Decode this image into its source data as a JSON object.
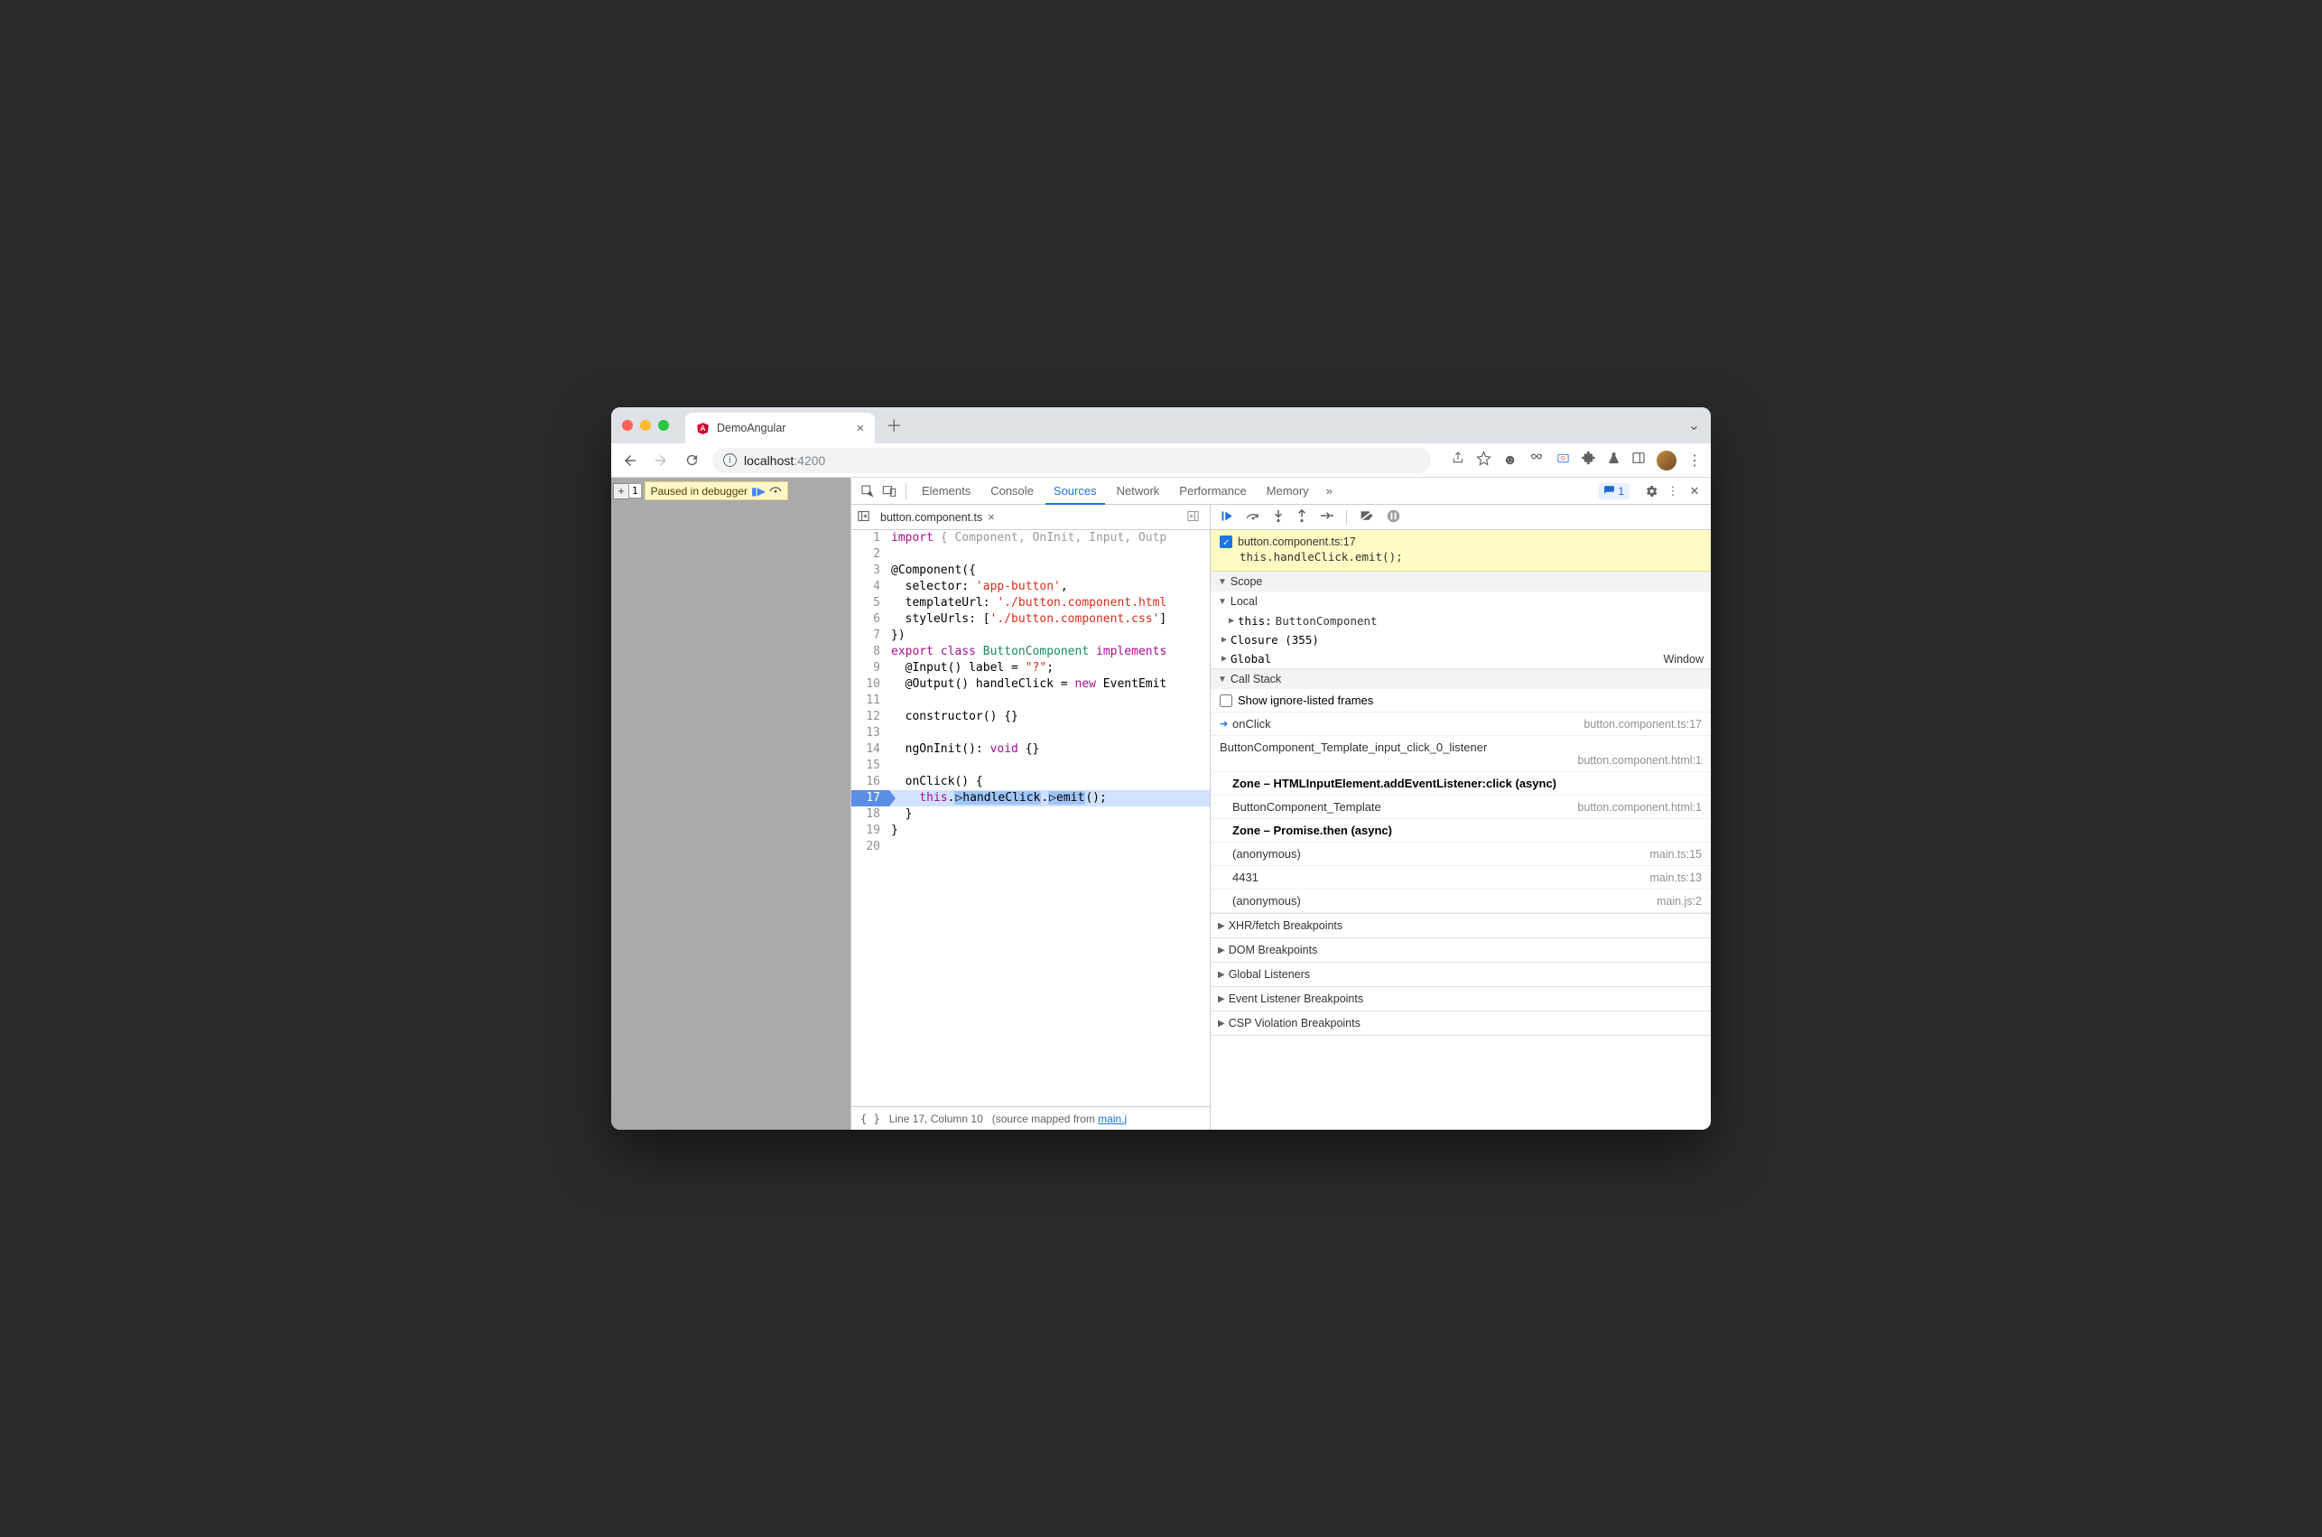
{
  "tab": {
    "title": "DemoAngular"
  },
  "url": {
    "host": "localhost",
    "port": ":4200"
  },
  "overlay": {
    "text": "Paused in debugger"
  },
  "devtools": {
    "tabs": [
      "Elements",
      "Console",
      "Sources",
      "Network",
      "Performance",
      "Memory"
    ],
    "issues_count": "1"
  },
  "editor": {
    "file": "button.component.ts",
    "status_line": "Line 17, Column 10",
    "status_mapped_prefix": "(source mapped from ",
    "status_mapped_link": "main.j",
    "lines": [
      {
        "n": "1",
        "raw": "import { Component, OnInit, Input, Outp"
      },
      {
        "n": "2",
        "raw": ""
      },
      {
        "n": "3",
        "raw": "@Component({"
      },
      {
        "n": "4",
        "raw": "  selector: 'app-button',"
      },
      {
        "n": "5",
        "raw": "  templateUrl: './button.component.html"
      },
      {
        "n": "6",
        "raw": "  styleUrls: ['./button.component.css']"
      },
      {
        "n": "7",
        "raw": "})"
      },
      {
        "n": "8",
        "raw": "export class ButtonComponent implements"
      },
      {
        "n": "9",
        "raw": "  @Input() label = \"?\";"
      },
      {
        "n": "10",
        "raw": "  @Output() handleClick = new EventEmit"
      },
      {
        "n": "11",
        "raw": ""
      },
      {
        "n": "12",
        "raw": "  constructor() {}"
      },
      {
        "n": "13",
        "raw": ""
      },
      {
        "n": "14",
        "raw": "  ngOnInit(): void {}"
      },
      {
        "n": "15",
        "raw": ""
      },
      {
        "n": "16",
        "raw": "  onClick() {"
      },
      {
        "n": "17",
        "raw": "    this.handleClick.emit();"
      },
      {
        "n": "18",
        "raw": "  }"
      },
      {
        "n": "19",
        "raw": "}"
      },
      {
        "n": "20",
        "raw": ""
      }
    ]
  },
  "bp": {
    "loc": "button.component.ts:17",
    "expr": "this.handleClick.emit();"
  },
  "sections": {
    "scope": "Scope",
    "local": "Local",
    "this_label": "this:",
    "this_val": "ButtonComponent",
    "closure": "Closure (355)",
    "global": "Global",
    "global_val": "Window",
    "callstack": "Call Stack",
    "show_ignore": "Show ignore-listed frames",
    "xhr": "XHR/fetch Breakpoints",
    "dom": "DOM Breakpoints",
    "gl": "Global Listeners",
    "ev": "Event Listener Breakpoints",
    "csp": "CSP Violation Breakpoints"
  },
  "frames": [
    {
      "arrow": true,
      "fn": "onClick",
      "loc": "button.component.ts:17"
    },
    {
      "fn": "ButtonComponent_Template_input_click_0_listener",
      "loc": "button.component.html:1",
      "wrap": true
    },
    {
      "zone": true,
      "fn": "Zone – HTMLInputElement.addEventListener:click (async)"
    },
    {
      "fn": "ButtonComponent_Template",
      "loc": "button.component.html:1"
    },
    {
      "zone": true,
      "fn": "Zone – Promise.then (async)"
    },
    {
      "fn": "(anonymous)",
      "loc": "main.ts:15"
    },
    {
      "fn": "4431",
      "loc": "main.ts:13"
    },
    {
      "fn": "(anonymous)",
      "loc": "main.js:2"
    }
  ]
}
